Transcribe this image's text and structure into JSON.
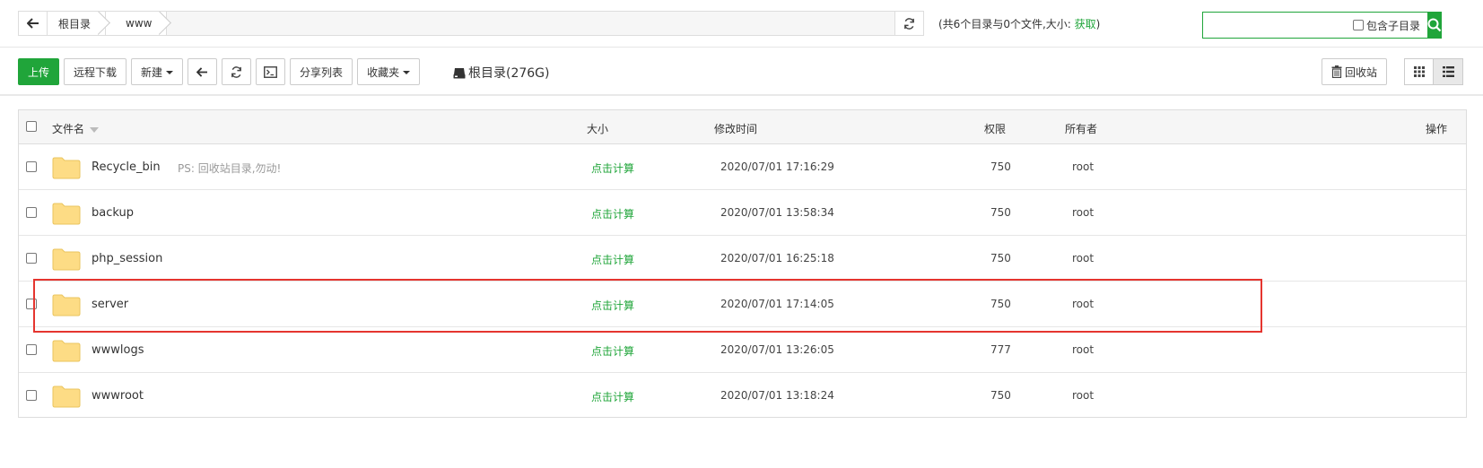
{
  "path": {
    "crumbs": [
      "根目录",
      "www"
    ],
    "summary_text": "(共6个目录与0个文件,大小: ",
    "summary_link": "获取",
    "summary_close": ")"
  },
  "search": {
    "placeholder": "",
    "value": "",
    "include_sub_label": "包含子目录"
  },
  "toolbar": {
    "upload": "上传",
    "remote_download": "远程下载",
    "new": "新建",
    "share_list": "分享列表",
    "favorites": "收藏夹",
    "disk_label": "根目录(276G)",
    "recycle": "回收站"
  },
  "table": {
    "headers": {
      "name": "文件名",
      "size": "大小",
      "mtime": "修改时间",
      "perm": "权限",
      "owner": "所有者",
      "action": "操作"
    },
    "rows": [
      {
        "name": "Recycle_bin",
        "note": "PS: 回收站目录,勿动!",
        "size": "点击计算",
        "mtime": "2020/07/01 17:16:29",
        "perm": "750",
        "owner": "root"
      },
      {
        "name": "backup",
        "note": "",
        "size": "点击计算",
        "mtime": "2020/07/01 13:58:34",
        "perm": "750",
        "owner": "root"
      },
      {
        "name": "php_session",
        "note": "",
        "size": "点击计算",
        "mtime": "2020/07/01 16:25:18",
        "perm": "750",
        "owner": "root"
      },
      {
        "name": "server",
        "note": "",
        "size": "点击计算",
        "mtime": "2020/07/01 17:14:05",
        "perm": "750",
        "owner": "root"
      },
      {
        "name": "wwwlogs",
        "note": "",
        "size": "点击计算",
        "mtime": "2020/07/01 13:26:05",
        "perm": "777",
        "owner": "root"
      },
      {
        "name": "wwwroot",
        "note": "",
        "size": "点击计算",
        "mtime": "2020/07/01 13:18:24",
        "perm": "750",
        "owner": "root"
      }
    ]
  },
  "colors": {
    "accent": "#20a53a",
    "highlight": "#e5352f",
    "folder": "#fddc85"
  },
  "icons": [
    "back-arrow-icon",
    "refresh-icon",
    "search-icon",
    "terminal-icon",
    "hdd-icon",
    "trash-icon",
    "grid-view-icon",
    "list-view-icon",
    "folder-icon",
    "sort-caret-icon"
  ]
}
